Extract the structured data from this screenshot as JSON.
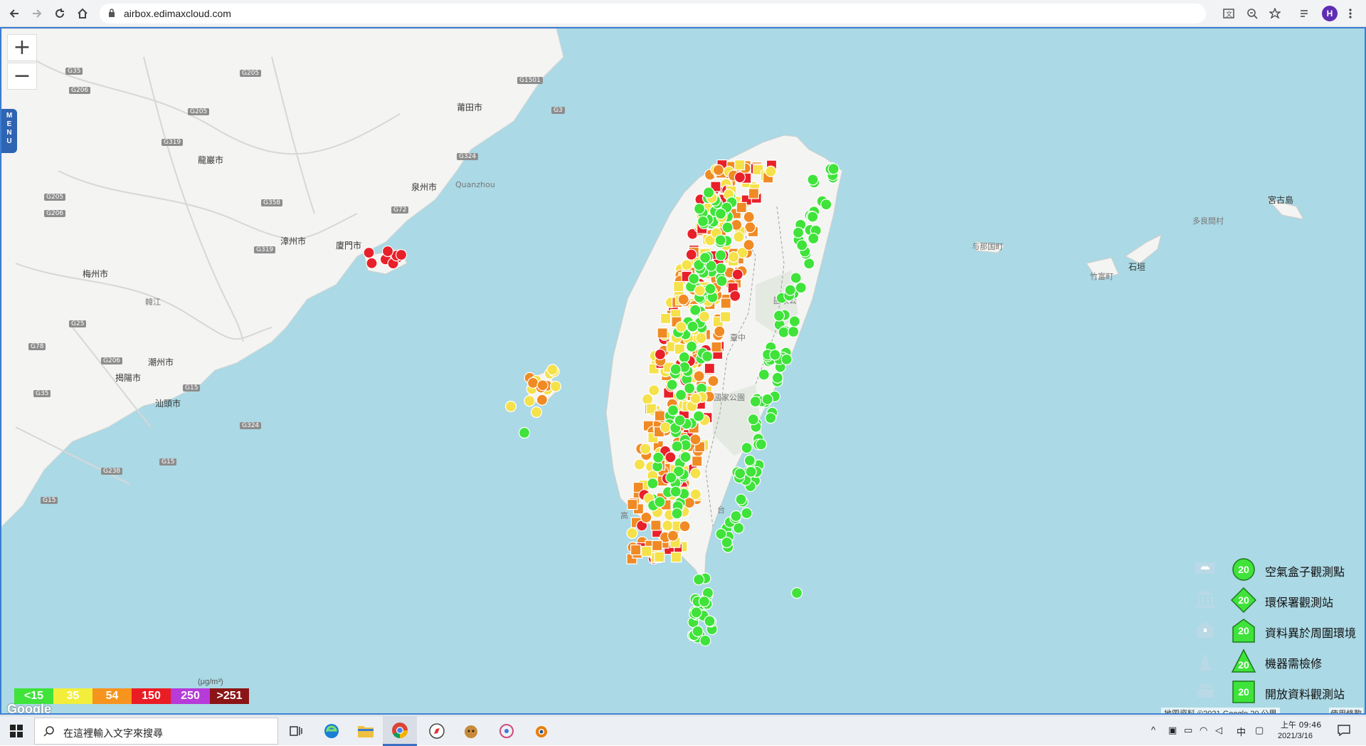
{
  "browser": {
    "url": "airbox.edimaxcloud.com",
    "profile_initial": "H"
  },
  "map": {
    "menu_label": "MENU",
    "zoom_in": "+",
    "zoom_out": "−",
    "place_labels": {
      "putian": "莆田市",
      "longyan": "龍巖市",
      "quanzhou": "泉州市",
      "quanzhou_sub": "Quanzhou",
      "zhangzhou": "漳州市",
      "xiamen": "廈門市",
      "meizhou": "梅州市",
      "hanjiang": "韓江",
      "chaozhou": "潮州市",
      "jieyang": "揭陽市",
      "shantou": "汕頭市",
      "miyakojima": "宮古島",
      "tarama": "多良間村",
      "yonaguni": "与那国町",
      "taketomi": "竹富町",
      "ishigaki": "石垣",
      "park_north": "國家公",
      "park_central": "山國家公園",
      "taichung": "臺中",
      "kaohsiung": "高",
      "taitung": "台"
    },
    "road_labels": [
      "G35",
      "G205",
      "G1501",
      "G3",
      "G206",
      "G319",
      "G205",
      "G324",
      "G205",
      "G358",
      "G72",
      "G206",
      "G319",
      "G25",
      "G78",
      "G206",
      "G35",
      "G15",
      "G324",
      "G15",
      "G238",
      "G15"
    ]
  },
  "scale_legend": {
    "unit": "(μg/m³)",
    "segments": [
      {
        "label": "<15",
        "color": "#3fe33a"
      },
      {
        "label": "35",
        "color": "#f2ee3a"
      },
      {
        "label": "54",
        "color": "#f7941e"
      },
      {
        "label": "150",
        "color": "#ea1c24"
      },
      {
        "label": "250",
        "color": "#b63bd8"
      },
      {
        "label": ">251",
        "color": "#8b1516"
      }
    ]
  },
  "attribution": {
    "google": "Google",
    "credit": "地圖資料 ©2021 Google   20 公里",
    "terms": "使用條款"
  },
  "legend": {
    "marker_value": "20",
    "items": [
      {
        "label": "空氣盒子觀測點",
        "shape": "circle",
        "icon": "cloud-box-icon"
      },
      {
        "label": "環保署觀測站",
        "shape": "diamond",
        "icon": "government-building-icon"
      },
      {
        "label": "資料異於周圍環境",
        "shape": "house",
        "icon": "house-icon"
      },
      {
        "label": "機器需檢修",
        "shape": "triangle",
        "icon": "cone-icon"
      },
      {
        "label": "開放資料觀測站",
        "shape": "square",
        "icon": "open-data-icon"
      }
    ]
  },
  "colors": {
    "green": "#3fe33a",
    "yellow": "#f5e14a",
    "orange": "#f08a24",
    "red": "#e8202a",
    "sea": "#abd9e5",
    "land": "#f4f4f2"
  },
  "taskbar": {
    "search_placeholder": "在這裡輸入文字來搜尋",
    "tray_ime": "中",
    "time": "上午 09:46",
    "date": "2021/3/16"
  }
}
